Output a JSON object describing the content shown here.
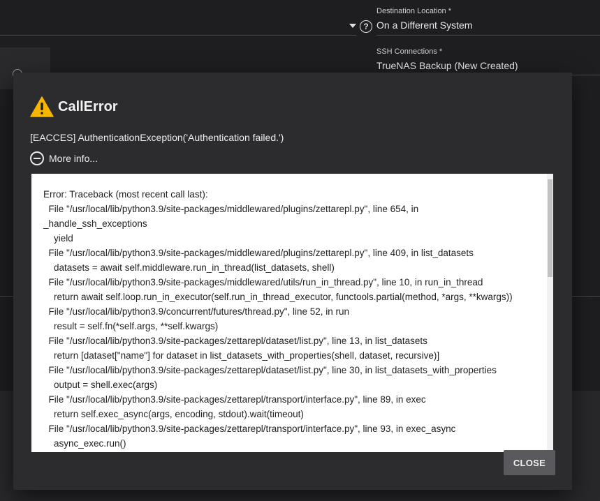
{
  "background": {
    "destination_location_label": "Destination Location *",
    "destination_location_value": "On a Different System",
    "ssh_connections_label": "SSH Connections *",
    "ssh_connections_value": "TrueNAS Backup (New Created)"
  },
  "dialog": {
    "title": "CallError",
    "message": "[EACCES] AuthenticationException('Authentication failed.')",
    "more_info_label": "More info...",
    "close_label": "CLOSE",
    "traceback_lines": [
      "Error: Traceback (most recent call last):",
      "  File \"/usr/local/lib/python3.9/site-packages/middlewared/plugins/zettarepl.py\", line 654, in",
      "_handle_ssh_exceptions",
      "    yield",
      "  File \"/usr/local/lib/python3.9/site-packages/middlewared/plugins/zettarepl.py\", line 409, in list_datasets",
      "    datasets = await self.middleware.run_in_thread(list_datasets, shell)",
      "  File \"/usr/local/lib/python3.9/site-packages/middlewared/utils/run_in_thread.py\", line 10, in run_in_thread",
      "    return await self.loop.run_in_executor(self.run_in_thread_executor, functools.partial(method, *args, **kwargs))",
      "  File \"/usr/local/lib/python3.9/concurrent/futures/thread.py\", line 52, in run",
      "    result = self.fn(*self.args, **self.kwargs)",
      "  File \"/usr/local/lib/python3.9/site-packages/zettarepl/dataset/list.py\", line 13, in list_datasets",
      "    return [dataset[\"name\"] for dataset in list_datasets_with_properties(shell, dataset, recursive)]",
      "  File \"/usr/local/lib/python3.9/site-packages/zettarepl/dataset/list.py\", line 30, in list_datasets_with_properties",
      "    output = shell.exec(args)",
      "  File \"/usr/local/lib/python3.9/site-packages/zettarepl/transport/interface.py\", line 89, in exec",
      "    return self.exec_async(args, encoding, stdout).wait(timeout)",
      "  File \"/usr/local/lib/python3.9/site-packages/zettarepl/transport/interface.py\", line 93, in exec_async",
      "    async_exec.run()"
    ]
  }
}
